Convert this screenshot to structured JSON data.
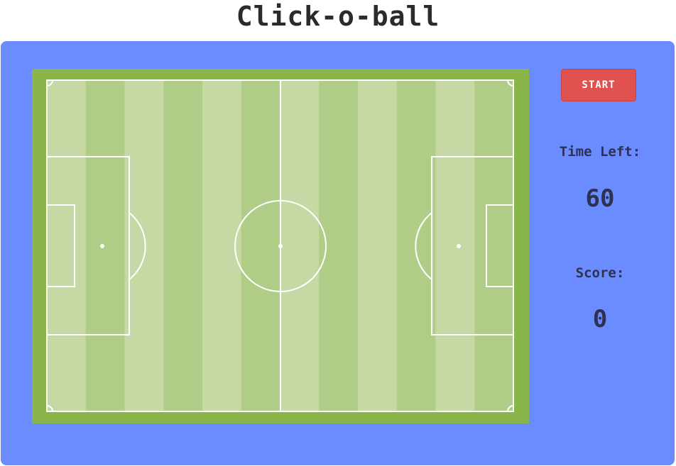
{
  "app": {
    "title": "Click-o-ball"
  },
  "controls": {
    "start_label": "START"
  },
  "stats": {
    "time_label": "Time Left:",
    "time_value": "60",
    "score_label": "Score:",
    "score_value": "0"
  },
  "colors": {
    "panel_bg": "#6b8cff",
    "field_border": "#8ab54a",
    "stripe_light": "#c6d9a5",
    "stripe_dark": "#b0cd88",
    "lines": "#ffffff",
    "start_button": "#e05250",
    "text_dark": "#2e3150"
  }
}
